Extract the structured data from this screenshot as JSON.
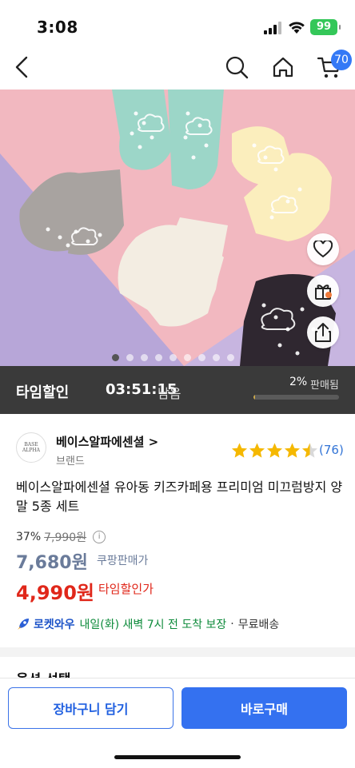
{
  "status_bar": {
    "time": "3:08",
    "battery": "99"
  },
  "nav": {
    "cart_count": "70"
  },
  "hero": {
    "slide_count": 9,
    "active_slide": 1
  },
  "timesale": {
    "label": "타임할인",
    "time": "03:51:15",
    "remaining": "남음",
    "percent": "2%",
    "sold_label": "판매됨",
    "sold_progress": 0.02
  },
  "brand": {
    "logo_line1": "BASE",
    "logo_line2": "ALPHA",
    "name": "베이스알파에센셜 >",
    "type": "브랜드"
  },
  "rating": {
    "stars": 4.5,
    "review_count": "(76)"
  },
  "product": {
    "title": "베이스알파에센셜 유아동 키즈카페용 프리미엄 미끄럼방지 양말 5종 세트"
  },
  "price": {
    "discount": "37%",
    "original": "7,990원",
    "coupang_price": "7,680원",
    "coupang_price_label": "쿠팡판매가",
    "time_price": "4,990원",
    "time_price_label": "타임할인가"
  },
  "delivery": {
    "brand": "로켓와우",
    "text": "내일(화) 새벽 7시 전 도착 보장",
    "separator": "·",
    "free": "무료배송"
  },
  "options": {
    "header": "옵션 선택"
  },
  "actions": {
    "add_to_cart": "장바구니 담기",
    "buy_now": "바로구매"
  },
  "colors": {
    "accent_blue": "#3471f0",
    "sale_red": "#e0271a",
    "price_gray": "#6a7b9a",
    "star_yellow": "#f5b800",
    "delivery_green": "#0c8a3a"
  }
}
